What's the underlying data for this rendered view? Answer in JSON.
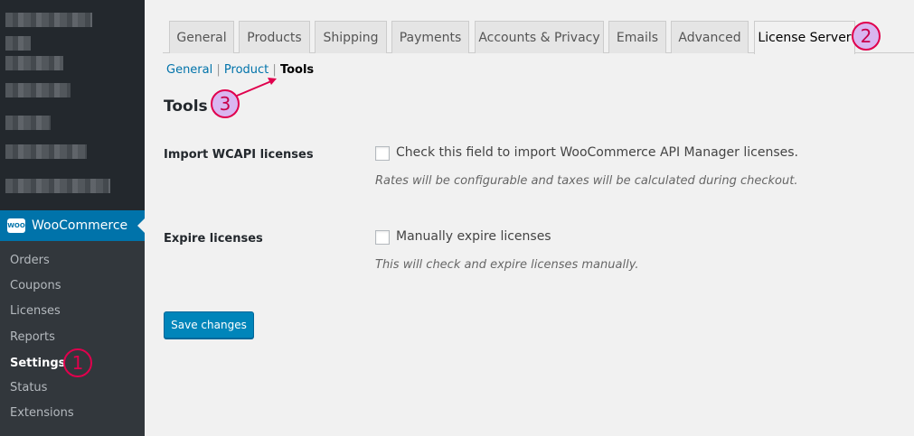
{
  "sidebar": {
    "menu_title": "WooCommerce",
    "logo_text": "WOO",
    "submenu": [
      {
        "label": "Orders"
      },
      {
        "label": "Coupons"
      },
      {
        "label": "Licenses"
      },
      {
        "label": "Reports"
      },
      {
        "label": "Settings"
      },
      {
        "label": "Status"
      },
      {
        "label": "Extensions"
      }
    ]
  },
  "tabs": [
    {
      "label": "General"
    },
    {
      "label": "Products"
    },
    {
      "label": "Shipping"
    },
    {
      "label": "Payments"
    },
    {
      "label": "Accounts & Privacy"
    },
    {
      "label": "Emails"
    },
    {
      "label": "Advanced"
    },
    {
      "label": "License Server"
    }
  ],
  "subnav": {
    "general": "General",
    "product": "Product",
    "tools": "Tools",
    "sep": "|"
  },
  "page": {
    "heading": "Tools",
    "rows": [
      {
        "label": "Import WCAPI licenses",
        "checkbox_label": "Check this field to import WooCommerce API Manager licenses.",
        "description": "Rates will be configurable and taxes will be calculated during checkout."
      },
      {
        "label": "Expire licenses",
        "checkbox_label": "Manually expire licenses",
        "description": "This will check and expire licenses manually."
      }
    ],
    "save_label": "Save changes"
  },
  "annotations": {
    "one": "1",
    "two": "2",
    "three": "3"
  }
}
